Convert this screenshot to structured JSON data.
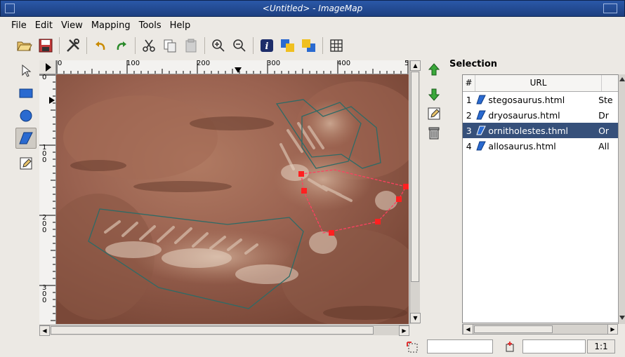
{
  "window": {
    "title": "<Untitled> - ImageMap"
  },
  "menu": {
    "items": [
      "File",
      "Edit",
      "View",
      "Mapping",
      "Tools",
      "Help"
    ]
  },
  "toolbar": {
    "icons": [
      "open-icon",
      "save-icon",
      "preferences-icon",
      "undo-icon",
      "redo-icon",
      "cut-icon",
      "copy-icon",
      "paste-icon",
      "zoom-in-icon",
      "zoom-out-icon",
      "info-icon",
      "to-front-icon",
      "to-back-icon",
      "grid-icon"
    ]
  },
  "tools": {
    "icons": [
      "arrow-icon",
      "rectangle-icon",
      "circle-icon",
      "polygon-icon",
      "edit-area-icon"
    ],
    "active": "polygon-icon"
  },
  "ruler": {
    "h_labels": [
      "0",
      "100",
      "200",
      "300",
      "400",
      "5"
    ],
    "v_labels": [
      "0",
      "1\n0\n0",
      "2\n0\n0",
      "3\n0\n0"
    ]
  },
  "selection": {
    "title": "Selection",
    "columns": [
      "#",
      "URL",
      ""
    ],
    "rows": [
      {
        "num": "1",
        "url": "stegosaurus.html",
        "alt": "Ste"
      },
      {
        "num": "2",
        "url": "dryosaurus.html",
        "alt": "Dr"
      },
      {
        "num": "3",
        "url": "ornitholestes.thml",
        "alt": "Or"
      },
      {
        "num": "4",
        "url": "allosaurus.html",
        "alt": "All"
      }
    ],
    "selected_index": 2
  },
  "status": {
    "zoom": "1:1"
  },
  "colors": {
    "selection": "#36507a",
    "titlebar": "#2a58a8",
    "handle": "#ff2020",
    "polygon": "#2e6b66"
  }
}
